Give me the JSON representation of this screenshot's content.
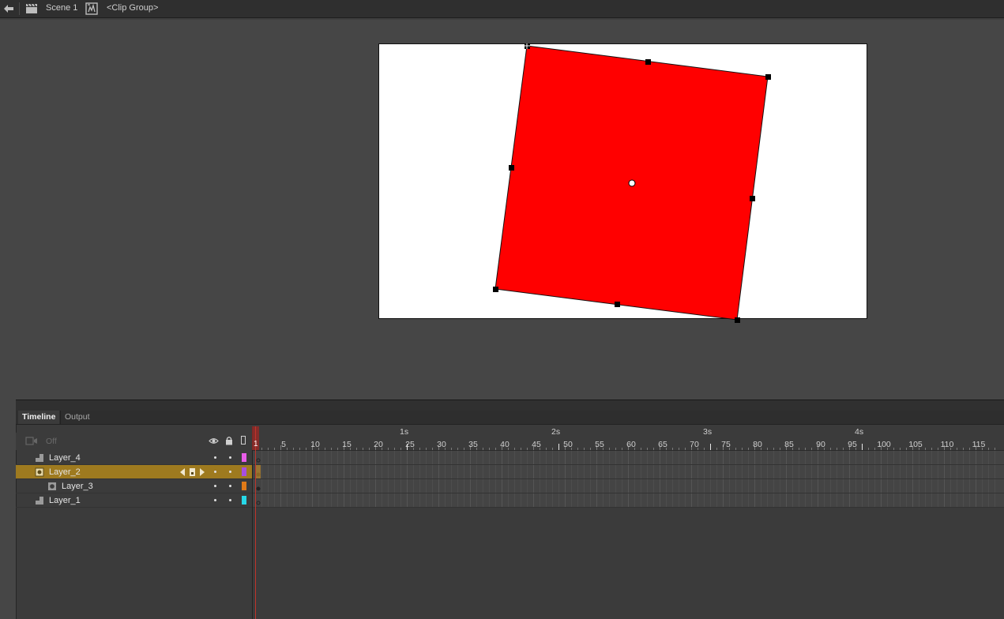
{
  "editbar": {
    "scene_label": "Scene 1",
    "clip_label": "<Clip Group>"
  },
  "stage": {
    "background": "#ffffff",
    "shape_fill": "#ff0000"
  },
  "timeline": {
    "tabs": [
      {
        "label": "Timeline",
        "active": true
      },
      {
        "label": "Output",
        "active": false
      }
    ],
    "header": {
      "off_label": "Off",
      "icons": [
        "eye-icon",
        "lock-icon",
        "outline-icon"
      ]
    },
    "layers": [
      {
        "name": "Layer_4",
        "type": "mask",
        "color": "#e85de8",
        "selected": false,
        "indent": 0
      },
      {
        "name": "Layer_2",
        "type": "normal",
        "color": "#a74ee0",
        "selected": true,
        "indent": 0
      },
      {
        "name": "Layer_3",
        "type": "masked",
        "color": "#e07a18",
        "selected": false,
        "indent": 1
      },
      {
        "name": "Layer_1",
        "type": "mask",
        "color": "#27d8e8",
        "selected": false,
        "indent": 0
      }
    ],
    "ruler": {
      "seconds": [
        "1s",
        "2s",
        "3s",
        "4s"
      ],
      "frames": [
        "5",
        "10",
        "15",
        "20",
        "25",
        "30",
        "35",
        "40",
        "45",
        "50",
        "55",
        "60",
        "65",
        "70",
        "75",
        "80",
        "85",
        "90",
        "95",
        "100",
        "105",
        "110",
        "115"
      ],
      "current_frame": "1"
    }
  }
}
